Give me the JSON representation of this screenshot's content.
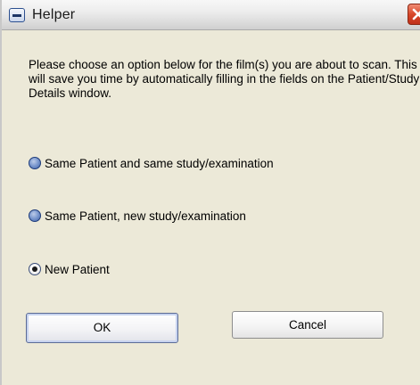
{
  "window": {
    "title": "Helper",
    "message": "Please choose an option below for the film(s) you are about to scan.  This will save you time by automatically filling in the fields on the Patient/Study Details window."
  },
  "options": [
    {
      "label": "Same Patient and same study/examination",
      "selected": false
    },
    {
      "label": "Same Patient, new study/examination",
      "selected": false
    },
    {
      "label": "New Patient",
      "selected": true
    }
  ],
  "buttons": {
    "ok_label": "OK",
    "cancel_label": "Cancel"
  },
  "icons": {
    "system": "window-menu-icon",
    "close": "close-icon"
  },
  "colors": {
    "dialog_bg": "#ece9d8",
    "close_button": "#d8482a",
    "radio_blue": "#3f62a8"
  }
}
